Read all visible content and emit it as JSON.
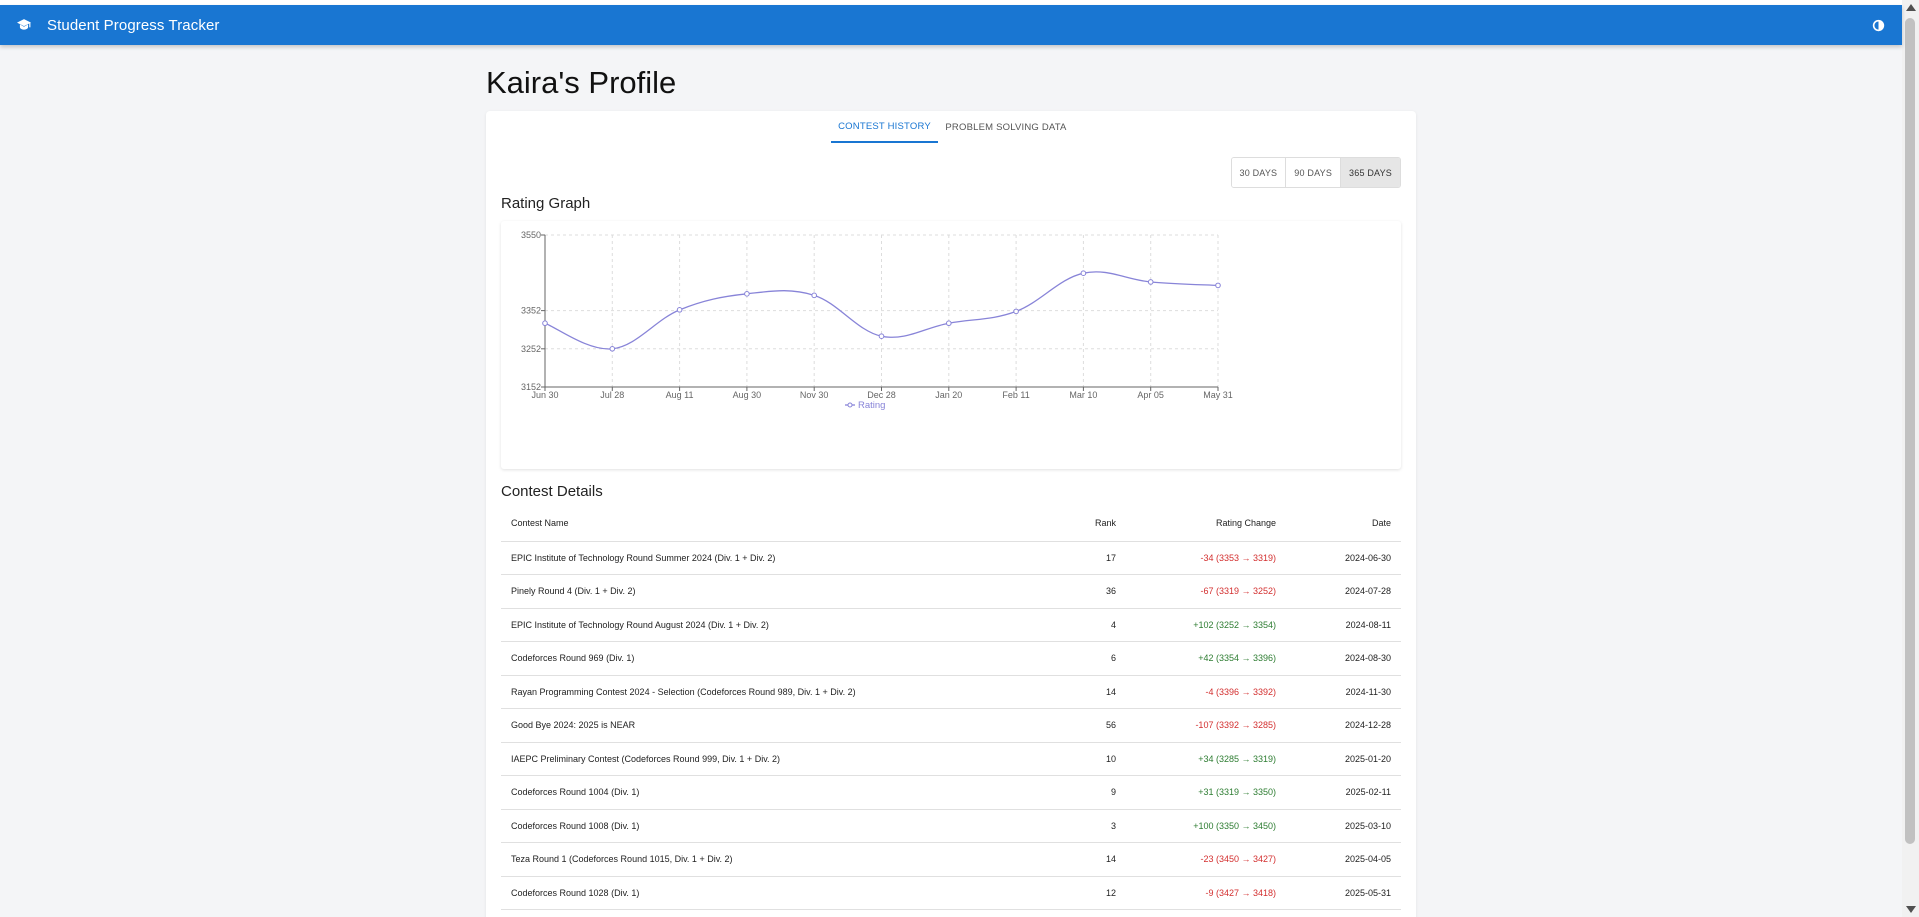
{
  "app": {
    "title": "Student Progress Tracker"
  },
  "page": {
    "title": "Kaira's Profile"
  },
  "tabs": [
    {
      "label": "CONTEST HISTORY",
      "active": true
    },
    {
      "label": "PROBLEM SOLVING DATA",
      "active": false
    }
  ],
  "range": {
    "options": [
      "30 DAYS",
      "90 DAYS",
      "365 DAYS"
    ],
    "selected": "365 DAYS"
  },
  "sections": {
    "rating_graph": "Rating Graph",
    "contest_details": "Contest Details"
  },
  "chart_data": {
    "type": "line",
    "title": "",
    "xlabel": "",
    "ylabel": "",
    "x": [
      "Jun 30",
      "Jul 28",
      "Aug 11",
      "Aug 30",
      "Nov 30",
      "Dec 28",
      "Jan 20",
      "Feb 11",
      "Mar 10",
      "Apr 05",
      "May 31"
    ],
    "series": [
      {
        "name": "Rating",
        "color": "#8884d8",
        "values": [
          3319,
          3252,
          3354,
          3396,
          3392,
          3285,
          3319,
          3350,
          3450,
          3427,
          3418
        ]
      }
    ],
    "yticks": [
      3152,
      3252,
      3352,
      3550
    ],
    "ylim": [
      3152,
      3550
    ],
    "grid": true,
    "legend": "bottom-center"
  },
  "table": {
    "headers": {
      "name": "Contest Name",
      "rank": "Rank",
      "change": "Rating Change",
      "date": "Date"
    },
    "rows": [
      {
        "name": "EPIC Institute of Technology Round Summer 2024 (Div. 1 + Div. 2)",
        "rank": "17",
        "change": "-34 (3353 → 3319)",
        "sign": "neg",
        "date": "2024-06-30"
      },
      {
        "name": "Pinely Round 4 (Div. 1 + Div. 2)",
        "rank": "36",
        "change": "-67 (3319 → 3252)",
        "sign": "neg",
        "date": "2024-07-28"
      },
      {
        "name": "EPIC Institute of Technology Round August 2024 (Div. 1 + Div. 2)",
        "rank": "4",
        "change": "+102 (3252 → 3354)",
        "sign": "pos",
        "date": "2024-08-11"
      },
      {
        "name": "Codeforces Round 969 (Div. 1)",
        "rank": "6",
        "change": "+42 (3354 → 3396)",
        "sign": "pos",
        "date": "2024-08-30"
      },
      {
        "name": "Rayan Programming Contest 2024 - Selection (Codeforces Round 989, Div. 1 + Div. 2)",
        "rank": "14",
        "change": "-4 (3396 → 3392)",
        "sign": "neg",
        "date": "2024-11-30"
      },
      {
        "name": "Good Bye 2024: 2025 is NEAR",
        "rank": "56",
        "change": "-107 (3392 → 3285)",
        "sign": "neg",
        "date": "2024-12-28"
      },
      {
        "name": "IAEPC Preliminary Contest (Codeforces Round 999, Div. 1 + Div. 2)",
        "rank": "10",
        "change": "+34 (3285 → 3319)",
        "sign": "pos",
        "date": "2025-01-20"
      },
      {
        "name": "Codeforces Round 1004 (Div. 1)",
        "rank": "9",
        "change": "+31 (3319 → 3350)",
        "sign": "pos",
        "date": "2025-02-11"
      },
      {
        "name": "Codeforces Round 1008 (Div. 1)",
        "rank": "3",
        "change": "+100 (3350 → 3450)",
        "sign": "pos",
        "date": "2025-03-10"
      },
      {
        "name": "Teza Round 1 (Codeforces Round 1015, Div. 1 + Div. 2)",
        "rank": "14",
        "change": "-23 (3450 → 3427)",
        "sign": "neg",
        "date": "2025-04-05"
      },
      {
        "name": "Codeforces Round 1028 (Div. 1)",
        "rank": "12",
        "change": "-9 (3427 → 3418)",
        "sign": "neg",
        "date": "2025-05-31"
      }
    ]
  }
}
